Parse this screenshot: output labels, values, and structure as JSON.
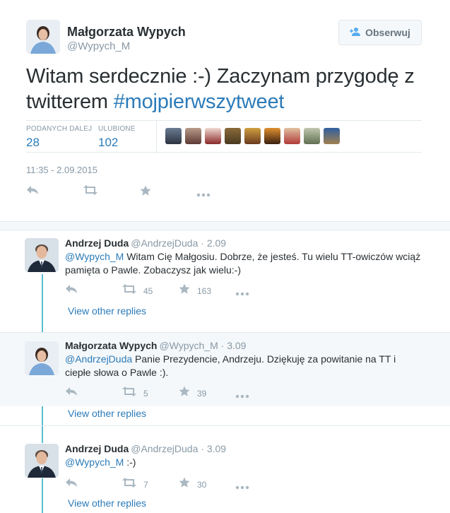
{
  "main_tweet": {
    "author_name": "Małgorzata Wypych",
    "author_handle": "@Wypych_M",
    "follow_label": "Obserwuj",
    "text": "Witam serdecznie :-) Zaczynam przygodę z twitterem ",
    "hashtag": "#mojpierwszytweet",
    "retweets_label": "PODANYCH DALEJ",
    "retweets_count": "28",
    "likes_label": "ULUBIONE",
    "likes_count": "102",
    "timestamp": "11:35 - 2.09.2015"
  },
  "replies": [
    {
      "name": "Andrzej Duda",
      "meta": "@AndrzejDuda · 2.09",
      "mention": "@Wypych_M",
      "text": " Witam Cię Małgosiu. Dobrze, że jesteś. Tu wielu TT-owiczów wciąż pamięta o Pawle. Zobaczysz jak wielu:-)",
      "retweets": "45",
      "likes": "163",
      "view_replies": "View other replies"
    },
    {
      "name": "Małgorzata Wypych",
      "meta": "@Wypych_M · 3.09",
      "mention": "@AndrzejDuda",
      "text": " Panie Prezydencie, Andrzeju. Dziękuję za powitanie na TT i ciepłe słowa o Pawle :).",
      "retweets": "5",
      "likes": "39",
      "view_replies": "View other replies"
    },
    {
      "name": "Andrzej Duda",
      "meta": "@AndrzejDuda · 3.09",
      "mention": "@Wypych_M",
      "text": " :-)",
      "retweets": "7",
      "likes": "30",
      "view_replies": "View other replies"
    }
  ],
  "icons": {
    "reply": "reply-icon",
    "retweet": "retweet-icon",
    "like": "star-icon",
    "more": "more-icon",
    "follow": "add-user-icon"
  },
  "colors": {
    "link": "#2b7bb9",
    "muted": "#8899a6",
    "thread": "#59bfd0",
    "alt_bg": "#f5f8fa"
  }
}
